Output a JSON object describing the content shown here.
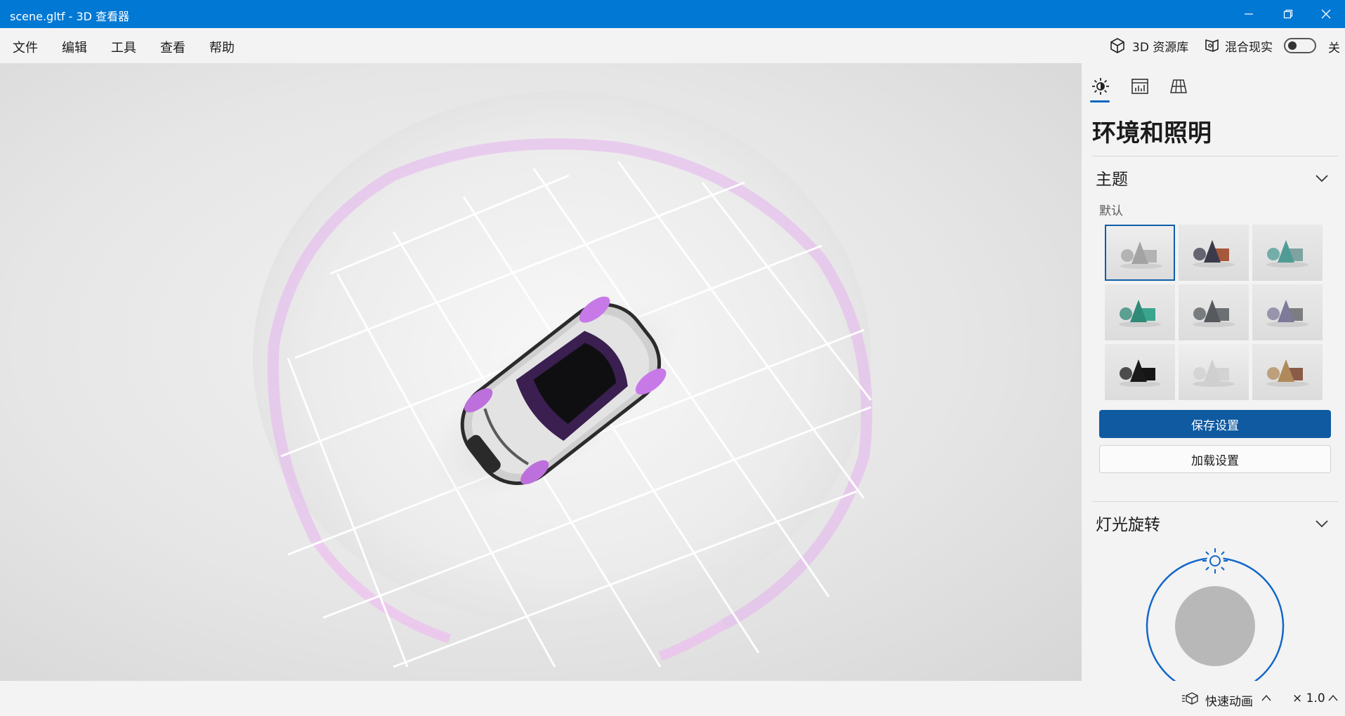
{
  "window": {
    "title": "scene.gltf - 3D 查看器"
  },
  "menu": {
    "items": [
      "文件",
      "编辑",
      "工具",
      "查看",
      "帮助"
    ]
  },
  "header": {
    "library_label": "3D 资源库",
    "mixed_reality_label": "混合现实",
    "toggle_state": "关"
  },
  "panel": {
    "tabs": [
      "sun-icon",
      "stats-icon",
      "grid-icon"
    ],
    "title": "环境和照明",
    "theme_section": {
      "title": "主题",
      "default_label": "默认",
      "selected_index": 0,
      "themes": [
        {
          "bg": "#eeeeee",
          "cone": "#a3a3a3",
          "box": "#b3b3b3"
        },
        {
          "bg": "#e9e9e9",
          "cone": "#3a3b4a",
          "box": "#a7583b"
        },
        {
          "bg": "#e9e9e9",
          "cone": "#4f9c95",
          "box": "#7fa3a0"
        },
        {
          "bg": "#e9e9e9",
          "cone": "#2f8a78",
          "box": "#39a58d"
        },
        {
          "bg": "#e9e9e9",
          "cone": "#56595d",
          "box": "#6d7073"
        },
        {
          "bg": "#e9e9e9",
          "cone": "#7d7a9a",
          "box": "#7b7d80"
        },
        {
          "bg": "#e9e9e9",
          "cone": "#1a1a1a",
          "box": "#161616"
        },
        {
          "bg": "#efefef",
          "cone": "#cfcfcf",
          "box": "#d3d3d3"
        },
        {
          "bg": "#e9e9e9",
          "cone": "#b0895a",
          "box": "#8a5b47"
        }
      ],
      "save_label": "保存设置",
      "load_label": "加载设置"
    },
    "light_section": {
      "title": "灯光旋转"
    }
  },
  "status": {
    "animation_label": "快速动画",
    "speed": "× 1.0"
  },
  "colors": {
    "accent": "#0078d4",
    "primary_button": "#0f5aa0",
    "glow": "#e8b0f0"
  }
}
